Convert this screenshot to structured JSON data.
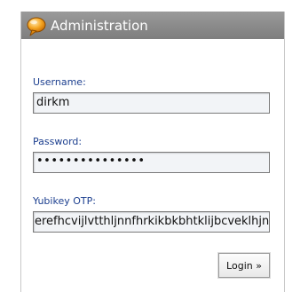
{
  "window": {
    "title": "Administration",
    "icon": "speech-bubble-icon"
  },
  "form": {
    "username": {
      "label": "Username:",
      "value": "dirkm"
    },
    "password": {
      "label": "Password:",
      "masked_value": "•••••••••••••••"
    },
    "otp": {
      "label": "Yubikey OTP:",
      "value": "erefhcvijlvtthljnnfhrkikbkbhtklijbcveklhjn"
    },
    "login_label": "Login »"
  },
  "colors": {
    "label": "#1c3f8f",
    "titlebar": "#8a8a8a",
    "icon": "#f5a623"
  }
}
